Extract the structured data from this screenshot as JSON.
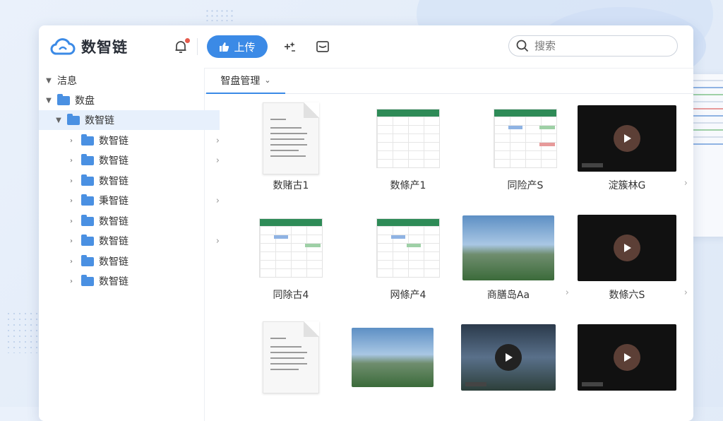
{
  "header": {
    "app_name": "数智链",
    "upload_label": "上传",
    "search_placeholder": "搜索"
  },
  "sidebar": {
    "items": [
      {
        "label": "洁息"
      },
      {
        "label": "数盘"
      },
      {
        "label": "数智链"
      },
      {
        "label": "数智链"
      },
      {
        "label": "数智链"
      },
      {
        "label": "数智链"
      },
      {
        "label": "秉智链"
      },
      {
        "label": "数智链"
      },
      {
        "label": "数智链"
      },
      {
        "label": "数智链"
      },
      {
        "label": "数智链"
      }
    ]
  },
  "tab": {
    "label": "智盘管理"
  },
  "files": [
    {
      "name": "数赌古1",
      "kind": "doc"
    },
    {
      "name": "数條产1",
      "kind": "sheet"
    },
    {
      "name": "同险产S",
      "kind": "sheet"
    },
    {
      "name": "淀簇林G",
      "kind": "video"
    },
    {
      "name": "同除古4",
      "kind": "sheet"
    },
    {
      "name": "网條产4",
      "kind": "sheet"
    },
    {
      "name": "商膳岛Aa",
      "kind": "photo"
    },
    {
      "name": "数條六S",
      "kind": "video"
    },
    {
      "name": "",
      "kind": "doc"
    },
    {
      "name": "",
      "kind": "photo"
    },
    {
      "name": "",
      "kind": "video"
    },
    {
      "name": "",
      "kind": "video"
    }
  ],
  "colors": {
    "accent": "#3b8ae6",
    "folder": "#4a90e2",
    "sheet_header": "#2e8b57",
    "notification": "#e55b4d"
  }
}
